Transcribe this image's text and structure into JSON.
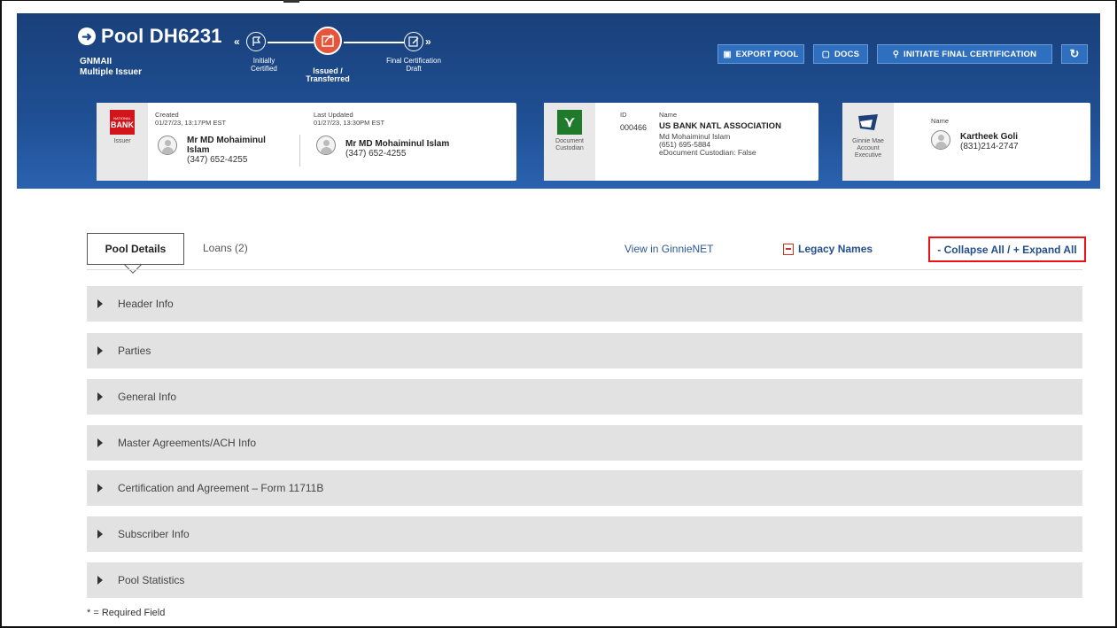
{
  "header": {
    "pool_title": "Pool DH6231",
    "pool_type": "GNMAII",
    "issuer_type": "Multiple Issuer",
    "steps": [
      {
        "label_line1": "Initially",
        "label_line2": "Certified",
        "state": "done"
      },
      {
        "label_line1": "Issued /",
        "label_line2": "Transferred",
        "state": "current"
      },
      {
        "label_line1": "Final Certification",
        "label_line2": "Draft",
        "state": "pending"
      }
    ],
    "buttons": {
      "export_pool": "EXPORT POOL",
      "docs": "DOCS",
      "initiate": "INITIATE FINAL CERTIFICATION"
    },
    "colors": {
      "header_bg": "#1f4f93",
      "active_step": "#e4553b",
      "button_bg": "#2f6fc0"
    }
  },
  "issuer_card": {
    "logo_text_top": "NATIONAL",
    "logo_text_main": "BANK",
    "side_label": "Issuer",
    "created_label": "Created",
    "created_value": "01/27/23, 13:17PM EST",
    "created_name_line1": "Mr MD Mohaiminul",
    "created_name_line2": "Islam",
    "created_phone": "(347) 652-4255",
    "updated_label": "Last Updated",
    "updated_value": "01/27/23, 13:30PM EST",
    "updated_name": "Mr MD Mohaiminul Islam",
    "updated_phone": "(347) 652-4255"
  },
  "custodian_card": {
    "side_label_line1": "Document",
    "side_label_line2": "Custodian",
    "id_label": "ID",
    "id_value": "000466",
    "name_label": "Name",
    "name_value": "US BANK NATL ASSOCIATION",
    "contact": "Md Mohaiminul Islam",
    "phone": "(651) 695-5884",
    "edoc": "eDocument Custodian: False"
  },
  "exec_card": {
    "side_label_line1": "Ginnie Mae",
    "side_label_line2": "Account",
    "side_label_line3": "Executive",
    "name_label": "Name",
    "name_value": "Kartheek Goli",
    "phone": "(831)214-2747"
  },
  "tabs": {
    "pool_details": "Pool Details",
    "loans": "Loans (2)",
    "view_ginnienet": "View in GinnieNET",
    "legacy_names": "Legacy Names",
    "collapse_expand": "- Collapse All / + Expand All"
  },
  "sections": [
    "Header Info",
    "Parties",
    "General Info",
    "Master Agreements/ACH Info",
    "Certification and Agreement – Form 11711B",
    "Subscriber Info",
    "Pool Statistics"
  ],
  "footer": {
    "required_note": "* = Required Field"
  }
}
